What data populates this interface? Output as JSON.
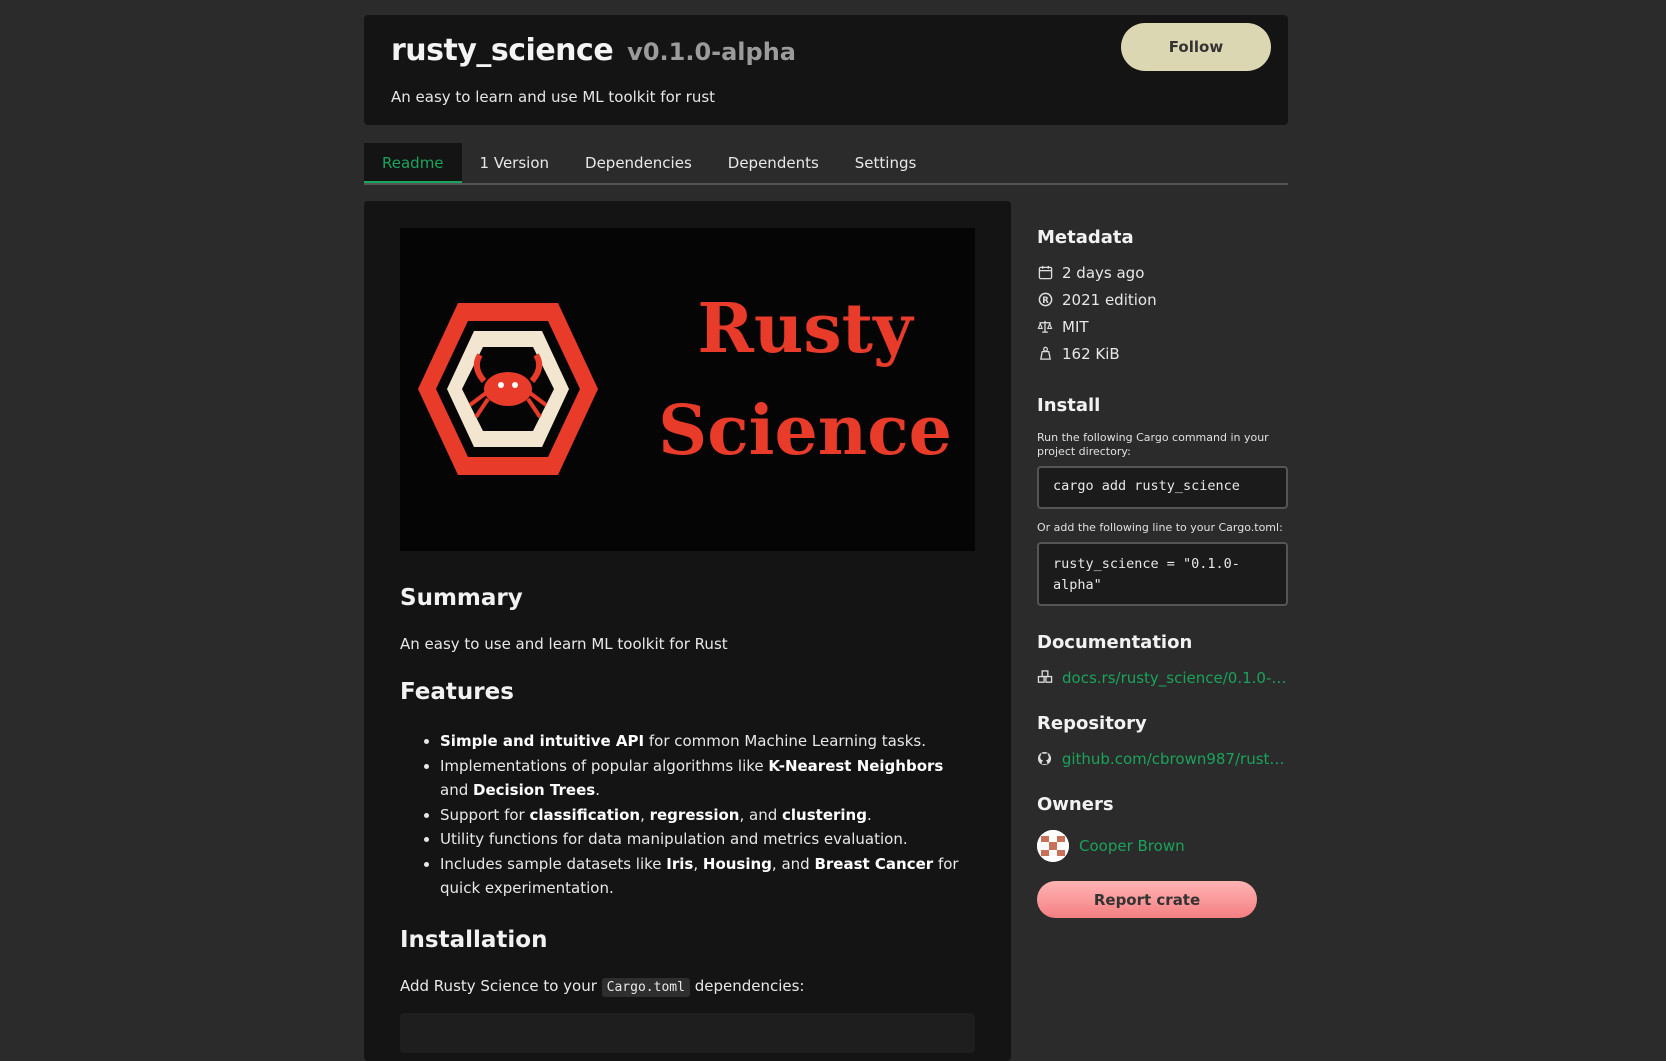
{
  "header": {
    "crate_name": "rusty_science",
    "version": "v0.1.0-alpha",
    "description": "An easy to learn and use ML toolkit for rust",
    "follow_label": "Follow"
  },
  "tabs": [
    {
      "label": "Readme",
      "active": true
    },
    {
      "label": "1 Version"
    },
    {
      "label": "Dependencies"
    },
    {
      "label": "Dependents"
    },
    {
      "label": "Settings"
    }
  ],
  "readme": {
    "banner_line1": "Rusty",
    "banner_line2": "Science",
    "summary_heading": "Summary",
    "summary_text": "An easy to use and learn ML toolkit for Rust",
    "features_heading": "Features",
    "features": {
      "f1_bold": "Simple and intuitive API",
      "f1_rest": " for common Machine Learning tasks.",
      "f2_a": "Implementations of popular algorithms like ",
      "f2_b1": "K-Nearest Neighbors",
      "f2_c": " and ",
      "f2_b2": "Decision Trees",
      "f2_d": ".",
      "f3_a": "Support for ",
      "f3_b1": "classification",
      "f3_c": ", ",
      "f3_b2": "regression",
      "f3_d": ", and ",
      "f3_b3": "clustering",
      "f3_e": ".",
      "f4": "Utility functions for data manipulation and metrics evaluation.",
      "f5_a": "Includes sample datasets like ",
      "f5_b1": "Iris",
      "f5_c": ", ",
      "f5_b2": "Housing",
      "f5_d": ", and ",
      "f5_b3": "Breast Cancer",
      "f5_e": " for quick experimentation."
    },
    "installation_heading": "Installation",
    "install_a": "Add Rusty Science to your ",
    "install_code": "Cargo.toml",
    "install_b": " dependencies:"
  },
  "sidebar": {
    "metadata_heading": "Metadata",
    "published": "2 days ago",
    "edition": "2021 edition",
    "license": "MIT",
    "size": "162 KiB",
    "install_heading": "Install",
    "install_hint": "Run the following Cargo command in your project directory:",
    "install_cmd": "cargo add rusty_science",
    "toml_hint": "Or add the following line to your Cargo.toml:",
    "toml_line": "rusty_science = \"0.1.0-alpha\"",
    "documentation_heading": "Documentation",
    "docs_link": "docs.rs/rusty_science/0.1.0-a...",
    "repository_heading": "Repository",
    "repo_link": "github.com/cbrown987/rusty...",
    "owners_heading": "Owners",
    "owner_name": "Cooper Brown",
    "report_label": "Report crate"
  },
  "colors": {
    "accent": "#1aa35c",
    "background": "#2b2b2b",
    "panel": "#141414",
    "banner_red": "#e83b2a",
    "follow_bg": "#dcd7b3",
    "report_bg": "#f47f82"
  }
}
